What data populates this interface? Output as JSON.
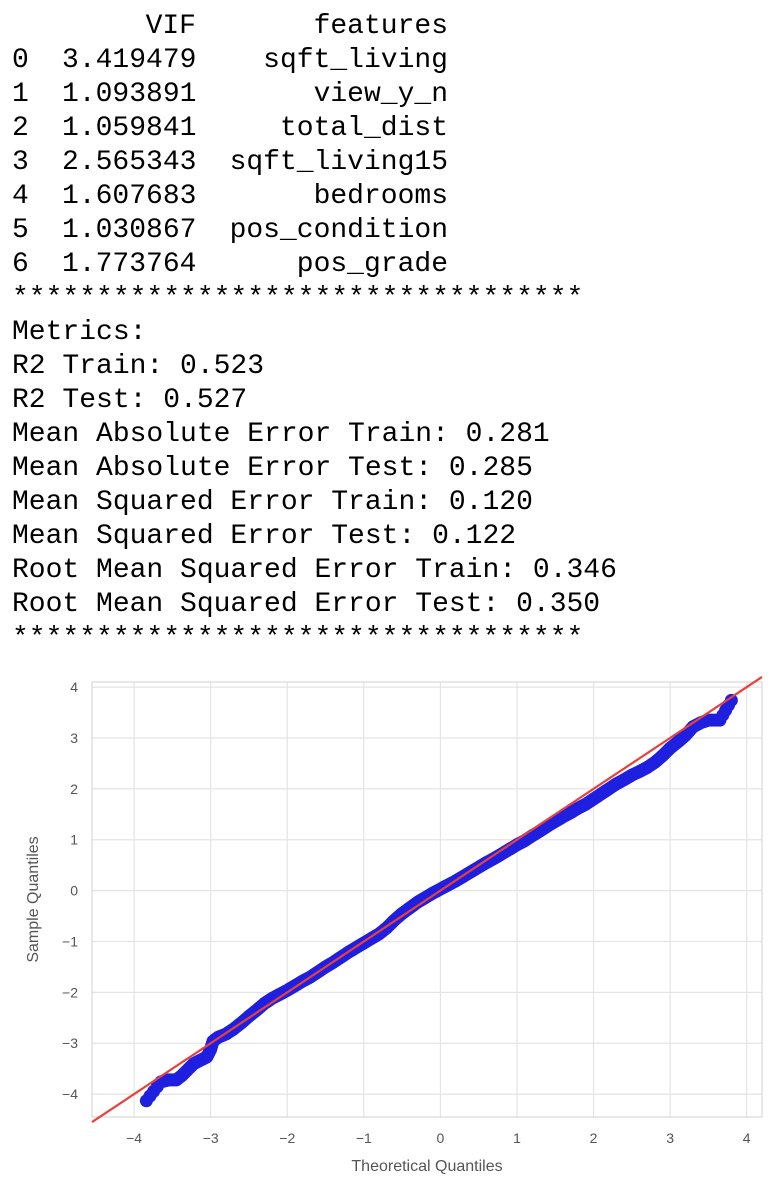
{
  "vif_table": {
    "header": {
      "index": "",
      "vif": "VIF",
      "features": "features"
    },
    "rows": [
      {
        "index": "0",
        "vif": "3.419479",
        "features": "sqft_living"
      },
      {
        "index": "1",
        "vif": "1.093891",
        "features": "view_y_n"
      },
      {
        "index": "2",
        "vif": "1.059841",
        "features": "total_dist"
      },
      {
        "index": "3",
        "vif": "2.565343",
        "features": "sqft_living15"
      },
      {
        "index": "4",
        "vif": "1.607683",
        "features": "bedrooms"
      },
      {
        "index": "5",
        "vif": "1.030867",
        "features": "pos_condition"
      },
      {
        "index": "6",
        "vif": "1.773764",
        "features": "pos_grade"
      }
    ]
  },
  "separator": "**********************************",
  "metrics": {
    "title": "Metrics:",
    "lines": [
      "R2 Train: 0.523",
      "R2 Test: 0.527",
      "Mean Absolute Error Train: 0.281",
      "Mean Absolute Error Test: 0.285",
      "Mean Squared Error Train: 0.120",
      "Mean Squared Error Test: 0.122",
      "Root Mean Squared Error Train: 0.346",
      "Root Mean Squared Error Test: 0.350"
    ]
  },
  "chart_data": {
    "type": "scatter",
    "title": "",
    "xlabel": "Theoretical Quantiles",
    "ylabel": "Sample Quantiles",
    "xlim": [
      -4.55,
      4.2
    ],
    "ylim": [
      -4.45,
      4.1
    ],
    "xticks": [
      -4,
      -3,
      -2,
      -1,
      0,
      1,
      2,
      3,
      4
    ],
    "yticks": [
      -4,
      -3,
      -2,
      -1,
      0,
      1,
      2,
      3,
      4
    ],
    "xtick_labels": [
      "−4",
      "−3",
      "−2",
      "−1",
      "0",
      "1",
      "2",
      "3",
      "4"
    ],
    "ytick_labels": [
      "−4",
      "−3",
      "−2",
      "−1",
      "0",
      "1",
      "2",
      "3",
      "4"
    ],
    "grid": true,
    "point_color": "#1f1fe0",
    "line_color": "#e8403a",
    "reference_line": {
      "slope": 1.0,
      "intercept": 0.0
    },
    "series": [
      {
        "points": [
          [
            -3.84,
            -4.13
          ],
          [
            -3.65,
            -3.76
          ],
          [
            -3.55,
            -3.72
          ],
          [
            -3.45,
            -3.72
          ],
          [
            -3.38,
            -3.64
          ],
          [
            -3.3,
            -3.52
          ],
          [
            -3.22,
            -3.4
          ],
          [
            -3.13,
            -3.33
          ],
          [
            -3.05,
            -3.27
          ],
          [
            -3.0,
            -3.12
          ],
          [
            -2.97,
            -2.96
          ],
          [
            -2.9,
            -2.88
          ],
          [
            -2.8,
            -2.82
          ],
          [
            -2.7,
            -2.72
          ],
          [
            -2.6,
            -2.6
          ],
          [
            -2.5,
            -2.47
          ],
          [
            -2.4,
            -2.35
          ],
          [
            -2.3,
            -2.22
          ],
          [
            -2.2,
            -2.12
          ],
          [
            -2.1,
            -2.04
          ],
          [
            -2.0,
            -1.96
          ],
          [
            -1.9,
            -1.87
          ],
          [
            -1.8,
            -1.78
          ],
          [
            -1.7,
            -1.7
          ],
          [
            -1.6,
            -1.6
          ],
          [
            -1.5,
            -1.5
          ],
          [
            -1.4,
            -1.41
          ],
          [
            -1.3,
            -1.31
          ],
          [
            -1.2,
            -1.21
          ],
          [
            -1.1,
            -1.12
          ],
          [
            -1.0,
            -1.03
          ],
          [
            -0.9,
            -0.94
          ],
          [
            -0.8,
            -0.85
          ],
          [
            -0.7,
            -0.73
          ],
          [
            -0.6,
            -0.58
          ],
          [
            -0.5,
            -0.45
          ],
          [
            -0.4,
            -0.34
          ],
          [
            -0.3,
            -0.23
          ],
          [
            -0.2,
            -0.14
          ],
          [
            -0.1,
            -0.05
          ],
          [
            0.0,
            0.03
          ],
          [
            0.1,
            0.11
          ],
          [
            0.2,
            0.19
          ],
          [
            0.3,
            0.28
          ],
          [
            0.4,
            0.37
          ],
          [
            0.5,
            0.46
          ],
          [
            0.6,
            0.55
          ],
          [
            0.7,
            0.63
          ],
          [
            0.8,
            0.72
          ],
          [
            0.9,
            0.81
          ],
          [
            1.0,
            0.9
          ],
          [
            1.1,
            0.98
          ],
          [
            1.2,
            1.08
          ],
          [
            1.3,
            1.17
          ],
          [
            1.4,
            1.27
          ],
          [
            1.5,
            1.36
          ],
          [
            1.6,
            1.45
          ],
          [
            1.7,
            1.53
          ],
          [
            1.8,
            1.62
          ],
          [
            1.9,
            1.7
          ],
          [
            2.0,
            1.8
          ],
          [
            2.1,
            1.9
          ],
          [
            2.2,
            2.0
          ],
          [
            2.3,
            2.1
          ],
          [
            2.4,
            2.18
          ],
          [
            2.5,
            2.27
          ],
          [
            2.6,
            2.34
          ],
          [
            2.7,
            2.42
          ],
          [
            2.8,
            2.52
          ],
          [
            2.9,
            2.65
          ],
          [
            3.0,
            2.8
          ],
          [
            3.1,
            2.92
          ],
          [
            3.2,
            3.05
          ],
          [
            3.3,
            3.22
          ],
          [
            3.4,
            3.3
          ],
          [
            3.5,
            3.35
          ],
          [
            3.65,
            3.35
          ],
          [
            3.8,
            3.74
          ]
        ]
      }
    ]
  }
}
